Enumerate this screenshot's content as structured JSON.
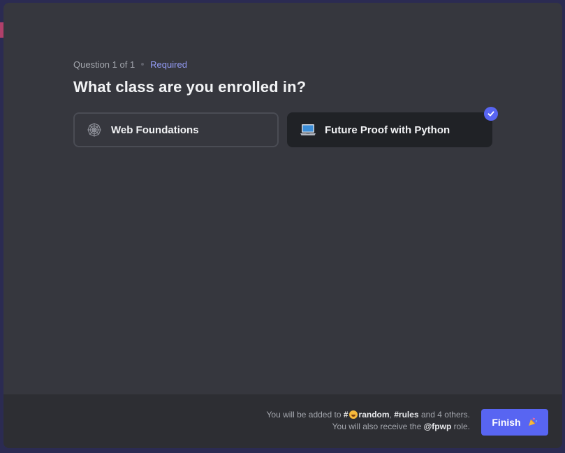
{
  "question": {
    "progress": "Question 1 of 1",
    "required_label": "Required",
    "title": "What class are you enrolled in?"
  },
  "options": [
    {
      "label": "Web Foundations",
      "icon": "spider-web-icon",
      "selected": false
    },
    {
      "label": "Future Proof with Python",
      "icon": "laptop-icon",
      "selected": true
    }
  ],
  "footer": {
    "note_prefix": "You will be added to",
    "channel_1": "#",
    "channel_1_name": "random",
    "separator_1": ",",
    "channel_2": "#rules",
    "note_middle": "and 4 others. You will also receive the",
    "role": "@fpwp",
    "note_suffix": "role.",
    "finish_label": "Finish",
    "finish_icon": "party-popper-icon"
  },
  "colors": {
    "accent": "#5865f2",
    "required": "#949cf7",
    "modal_bg": "#36373e",
    "footer_bg": "#2d2e33"
  }
}
